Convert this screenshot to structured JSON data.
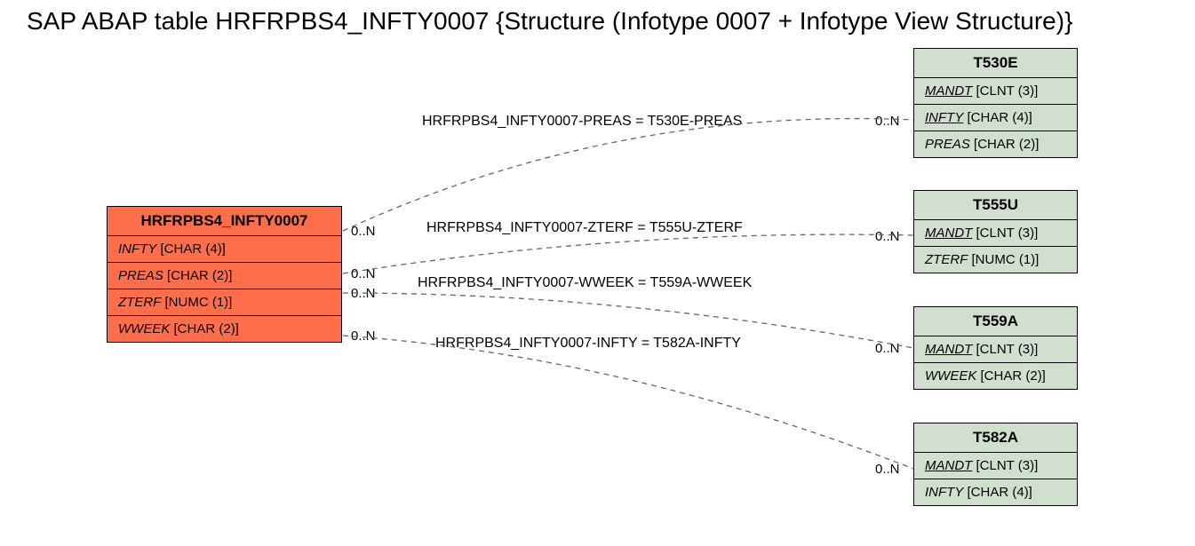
{
  "title": "SAP ABAP table HRFRPBS4_INFTY0007 {Structure  (Infotype 0007 + Infotype View Structure)}",
  "source": {
    "name": "HRFRPBS4_INFTY0007",
    "fields": [
      {
        "name": "INFTY",
        "type": "[CHAR (4)]"
      },
      {
        "name": "PREAS",
        "type": "[CHAR (2)]"
      },
      {
        "name": "ZTERF",
        "type": "[NUMC (1)]"
      },
      {
        "name": "WWEEK",
        "type": "[CHAR (2)]"
      }
    ]
  },
  "targets": [
    {
      "name": "T530E",
      "fields": [
        {
          "name": "MANDT",
          "type": "[CLNT (3)]",
          "key": true
        },
        {
          "name": "INFTY",
          "type": "[CHAR (4)]",
          "key": true
        },
        {
          "name": "PREAS",
          "type": "[CHAR (2)]",
          "key": false
        }
      ]
    },
    {
      "name": "T555U",
      "fields": [
        {
          "name": "MANDT",
          "type": "[CLNT (3)]",
          "key": true
        },
        {
          "name": "ZTERF",
          "type": "[NUMC (1)]",
          "key": false
        }
      ]
    },
    {
      "name": "T559A",
      "fields": [
        {
          "name": "MANDT",
          "type": "[CLNT (3)]",
          "key": true
        },
        {
          "name": "WWEEK",
          "type": "[CHAR (2)]",
          "key": false
        }
      ]
    },
    {
      "name": "T582A",
      "fields": [
        {
          "name": "MANDT",
          "type": "[CLNT (3)]",
          "key": true
        },
        {
          "name": "INFTY",
          "type": "[CHAR (4)]",
          "key": false
        }
      ]
    }
  ],
  "relations": [
    {
      "label": "HRFRPBS4_INFTY0007-PREAS = T530E-PREAS",
      "src_card": "0..N",
      "tgt_card": "0..N"
    },
    {
      "label": "HRFRPBS4_INFTY0007-ZTERF = T555U-ZTERF",
      "src_card": "0..N",
      "tgt_card": "0..N"
    },
    {
      "label": "HRFRPBS4_INFTY0007-WWEEK = T559A-WWEEK",
      "src_card": "0..N",
      "tgt_card": "0..N"
    },
    {
      "label": "HRFRPBS4_INFTY0007-INFTY = T582A-INFTY",
      "src_card": "0..N",
      "tgt_card": "0..N"
    }
  ]
}
